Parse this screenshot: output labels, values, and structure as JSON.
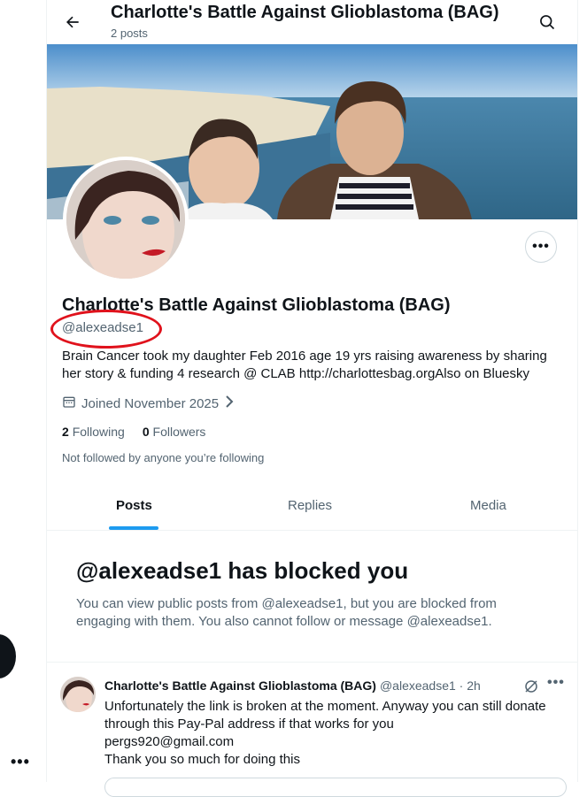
{
  "header": {
    "title": "Charlotte's Battle Against Glioblastoma (BAG)",
    "post_count": "2 posts"
  },
  "profile": {
    "name": "Charlotte's Battle Against Glioblastoma (BAG)",
    "handle": "@alexeadse1",
    "bio": "Brain Cancer took my daughter Feb 2016 age 19 yrs raising awareness by sharing her story & funding 4 research @ CLAB http://charlottesbag.orgAlso on Bluesky",
    "joined": "Joined November 2025",
    "following_count": "2",
    "following_label": "Following",
    "followers_count": "0",
    "followers_label": "Followers",
    "not_followed": "Not followed by anyone you’re following"
  },
  "tabs": [
    {
      "label": "Posts",
      "active": true
    },
    {
      "label": "Replies",
      "active": false
    },
    {
      "label": "Media",
      "active": false
    }
  ],
  "blocked": {
    "title": "@alexeadse1 has blocked you",
    "body": "You can view public posts from @alexeadse1, but you are blocked from engaging with them. You also cannot follow or message @alexeadse1."
  },
  "post": {
    "author": "Charlotte's Battle Against Glioblastoma (BAG)",
    "meta": "@alexeadse1 · 2h",
    "text": "Unfortunately the link is broken at the moment. Anyway you can still donate through this Pay-Pal address if that works for you\npergs920@gmail.com\nThank you so much for doing this"
  },
  "colors": {
    "accent": "#1d9bf0",
    "annotation_red": "#e0121c",
    "muted_text": "#536471"
  }
}
